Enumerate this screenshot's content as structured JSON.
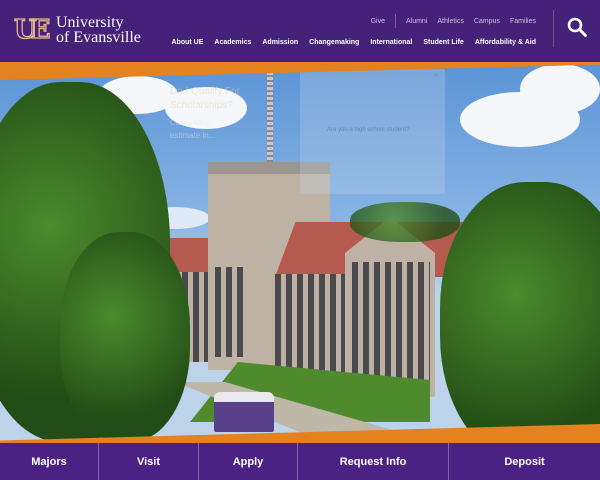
{
  "header": {
    "logo_mark": "UE",
    "logo_line1": "University",
    "logo_line2": "of Evansville",
    "utility_nav": [
      "Give",
      "Alumni",
      "Athletics",
      "Campus",
      "Families"
    ],
    "main_nav": [
      "About UE",
      "Academics",
      "Admission",
      "Changemaking",
      "International",
      "Student Life",
      "Affordability & Aid"
    ]
  },
  "popup": {
    "title": "Do I Qualify For Scholarships?",
    "subtitle_line1": "Calculate y...",
    "subtitle_line2": "estimate in...",
    "question": "Are you a high school student?",
    "close": "×"
  },
  "bottom_nav": [
    "Majors",
    "Visit",
    "Apply",
    "Request Info",
    "Deposit"
  ],
  "colors": {
    "purple": "#45217a",
    "orange": "#e3821f"
  }
}
